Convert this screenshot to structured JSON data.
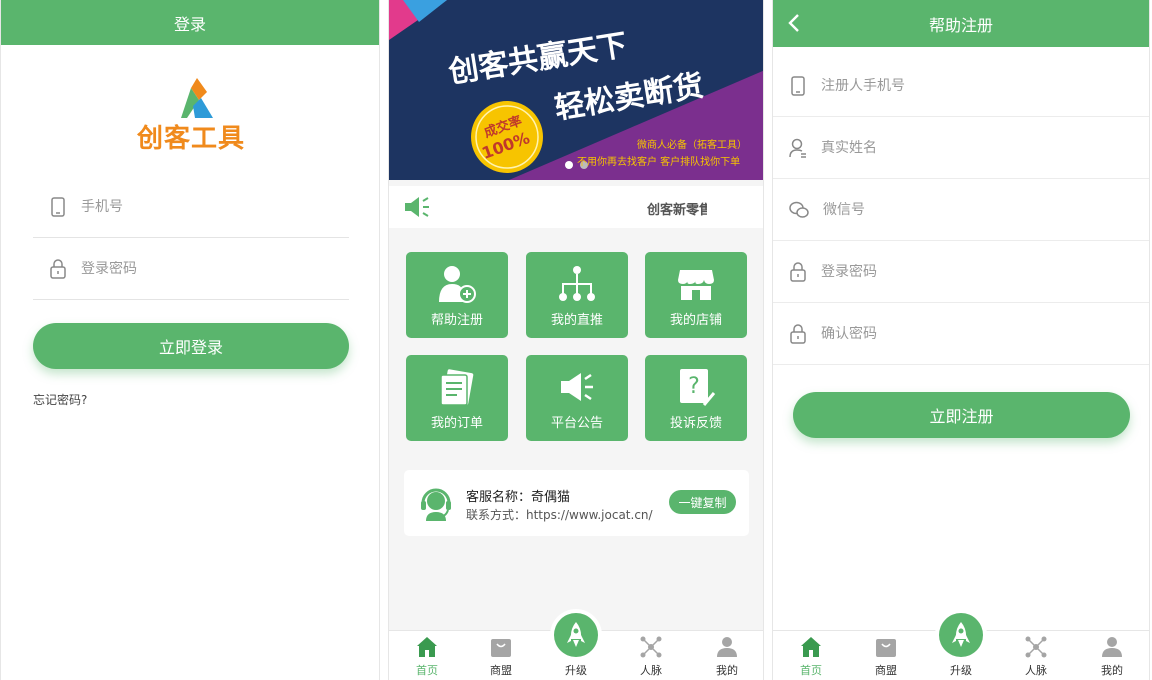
{
  "colors": {
    "primary": "#5ab56d",
    "logo_orange": "#f08a1c",
    "banner_navy": "#1d3461",
    "banner_purple": "#7b2f8e"
  },
  "login": {
    "title": "登录",
    "logo_text": "创客工具",
    "phone_placeholder": "手机号",
    "password_placeholder": "登录密码",
    "login_button": "立即登录",
    "forgot": "忘记密码?"
  },
  "home": {
    "banner": {
      "line1": "创客共赢天下",
      "line2": "轻松卖断货",
      "badge_line1": "成交率",
      "badge_line2": "100%",
      "sub1": "微商人必备（拓客工具）",
      "sub2": "不用你再去找客户 客户排队找你下单"
    },
    "ticker_icon": "megaphone-icon",
    "ticker_text": "创客新零售",
    "tiles": [
      {
        "label": "帮助注册",
        "icon": "add-user-icon"
      },
      {
        "label": "我的直推",
        "icon": "network-tree-icon"
      },
      {
        "label": "我的店铺",
        "icon": "store-icon"
      },
      {
        "label": "我的订单",
        "icon": "order-list-icon"
      },
      {
        "label": "平台公告",
        "icon": "announcement-icon"
      },
      {
        "label": "投诉反馈",
        "icon": "feedback-icon"
      }
    ],
    "service": {
      "name": "客服名称：奇偶猫",
      "contact": "联系方式：https://www.jocat.cn/",
      "copy_button": "一键复制"
    }
  },
  "tabs": [
    {
      "label": "首页",
      "icon": "home-icon"
    },
    {
      "label": "商盟",
      "icon": "shopping-bag-icon"
    },
    {
      "label": "升级",
      "icon": "rocket-icon"
    },
    {
      "label": "人脉",
      "icon": "network-icon"
    },
    {
      "label": "我的",
      "icon": "user-icon"
    }
  ],
  "register": {
    "title": "帮助注册",
    "fields": [
      {
        "placeholder": "注册人手机号",
        "icon": "phone-icon"
      },
      {
        "placeholder": "真实姓名",
        "icon": "user-icon"
      },
      {
        "placeholder": "微信号",
        "icon": "wechat-icon"
      },
      {
        "placeholder": "登录密码",
        "icon": "lock-icon"
      },
      {
        "placeholder": "确认密码",
        "icon": "lock-icon"
      }
    ],
    "submit_button": "立即注册"
  }
}
